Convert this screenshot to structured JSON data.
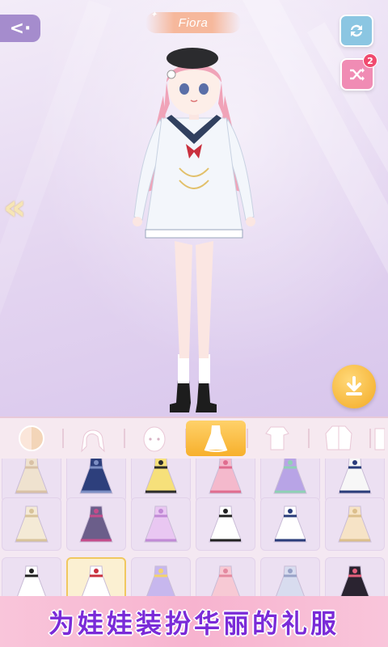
{
  "character": {
    "name": "Fiora"
  },
  "toolbar": {
    "back_icon": "double-chevron-left-icon",
    "refresh_icon": "refresh-icon",
    "shuffle_icon": "shuffle-icon",
    "shuffle_badge": "2",
    "prev_icon": "double-chevron-left-icon",
    "download_icon": "download-icon"
  },
  "categories": [
    {
      "id": "skin",
      "icon": "skin-icon",
      "active": false
    },
    {
      "id": "hair",
      "icon": "hair-icon",
      "active": false
    },
    {
      "id": "face",
      "icon": "face-icon",
      "active": false
    },
    {
      "id": "dress",
      "icon": "dress-icon",
      "active": true
    },
    {
      "id": "top",
      "icon": "top-icon",
      "active": false
    },
    {
      "id": "coat",
      "icon": "coat-icon",
      "active": false
    }
  ],
  "items": [
    {
      "row": 0,
      "col": 0,
      "color": "#efe2cf",
      "accent": "#d9c1a6"
    },
    {
      "row": 0,
      "col": 1,
      "color": "#2d3f7c",
      "accent": "#7d8fc4"
    },
    {
      "row": 0,
      "col": 2,
      "color": "#f6e07a",
      "accent": "#2b2b2b"
    },
    {
      "row": 0,
      "col": 3,
      "color": "#f4b9cc",
      "accent": "#e06c8f"
    },
    {
      "row": 0,
      "col": 4,
      "color": "#b8a4e6",
      "accent": "#8fd1b5"
    },
    {
      "row": 0,
      "col": 5,
      "color": "#f7f7f7",
      "accent": "#2a3c7a"
    },
    {
      "row": 1,
      "col": 0,
      "color": "#f4ead6",
      "accent": "#d8c39a"
    },
    {
      "row": 1,
      "col": 1,
      "color": "#6b5e8a",
      "accent": "#c44c8b"
    },
    {
      "row": 1,
      "col": 2,
      "color": "#e9c7f2",
      "accent": "#c18ad6"
    },
    {
      "row": 1,
      "col": 3,
      "color": "#ffffff",
      "accent": "#222222"
    },
    {
      "row": 1,
      "col": 4,
      "color": "#ffffff",
      "accent": "#2a3c7a"
    },
    {
      "row": 1,
      "col": 5,
      "color": "#f6e3c6",
      "accent": "#dcbf8c"
    },
    {
      "row": 2,
      "col": 0,
      "color": "#ffffff",
      "accent": "#222222"
    },
    {
      "row": 2,
      "col": 1,
      "color": "#ffffff",
      "accent": "#c9303e",
      "selected": true
    },
    {
      "row": 2,
      "col": 2,
      "color": "#c7b7ee",
      "accent": "#f3d36c"
    },
    {
      "row": 2,
      "col": 3,
      "color": "#f7c9d4",
      "accent": "#e48aa0"
    },
    {
      "row": 2,
      "col": 4,
      "color": "#d8dcef",
      "accent": "#9aa3c8"
    },
    {
      "row": 2,
      "col": 5,
      "color": "#2a2330",
      "accent": "#e4607c"
    }
  ],
  "banner": {
    "text": "为娃娃装扮华丽的礼服"
  },
  "colors": {
    "accent_gold": "#f7b02c",
    "banner_text": "#7a2bd8",
    "back_button": "#a58ccd"
  }
}
